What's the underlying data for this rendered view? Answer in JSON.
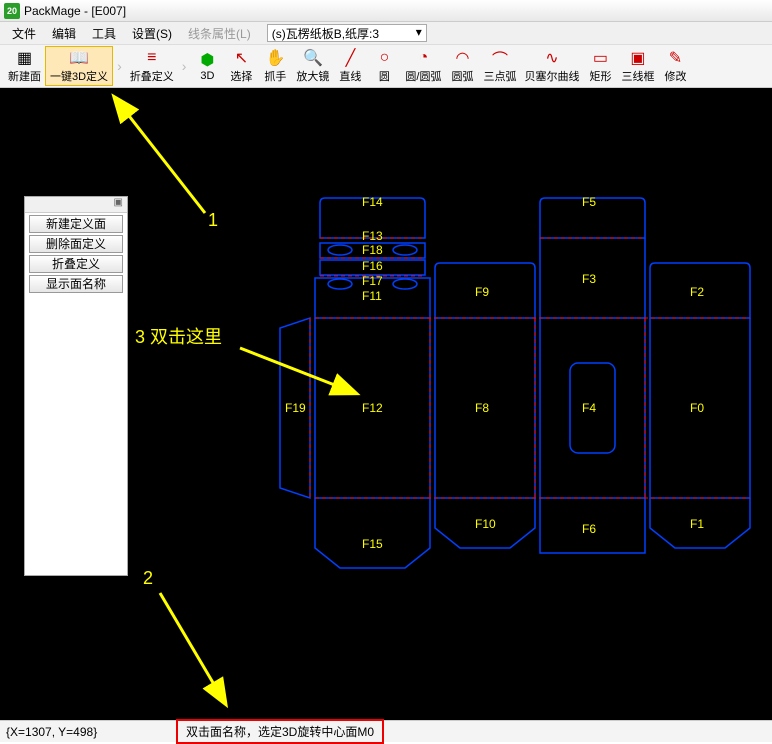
{
  "title": "PackMage - [E007]",
  "app_icon_text": "20",
  "menu": {
    "file": "文件",
    "edit": "编辑",
    "tool": "工具",
    "settings": "设置(S)",
    "line_attr": "线条属性(L)",
    "dropdown_value": "(s)瓦楞纸板B,纸厚:3"
  },
  "toolbar": {
    "new_face": "新建面",
    "oneclick_3d": "一键3D定义",
    "fold_def": "折叠定义",
    "threed": "3D",
    "select": "选择",
    "grab": "抓手",
    "magnify": "放大镜",
    "line": "直线",
    "circle": "圆",
    "circle_arc": "圆/圆弧",
    "arc": "圆弧",
    "three_pt_arc": "三点弧",
    "bezier": "贝塞尔曲线",
    "rect": "矩形",
    "three_wire": "三线框",
    "modify": "修改"
  },
  "side_panel": {
    "b1": "新建定义面",
    "b2": "删除面定义",
    "b3": "折叠定义",
    "b4": "显示面名称"
  },
  "faces": {
    "f0": "F0",
    "f1": "F1",
    "f2": "F2",
    "f3": "F3",
    "f4": "F4",
    "f5": "F5",
    "f6": "F6",
    "f8": "F8",
    "f9": "F9",
    "f10": "F10",
    "f11": "F11",
    "f12": "F12",
    "f13": "F13",
    "f14": "F14",
    "f15": "F15",
    "f16": "F16",
    "f17": "F17",
    "f18": "F18",
    "f19": "F19"
  },
  "annotations": {
    "a1": "1",
    "a2": "2",
    "a3": "3  双击这里"
  },
  "status": {
    "coords": "{X=1307, Y=498}",
    "hint": "双击面名称，选定3D旋转中心面M0"
  }
}
